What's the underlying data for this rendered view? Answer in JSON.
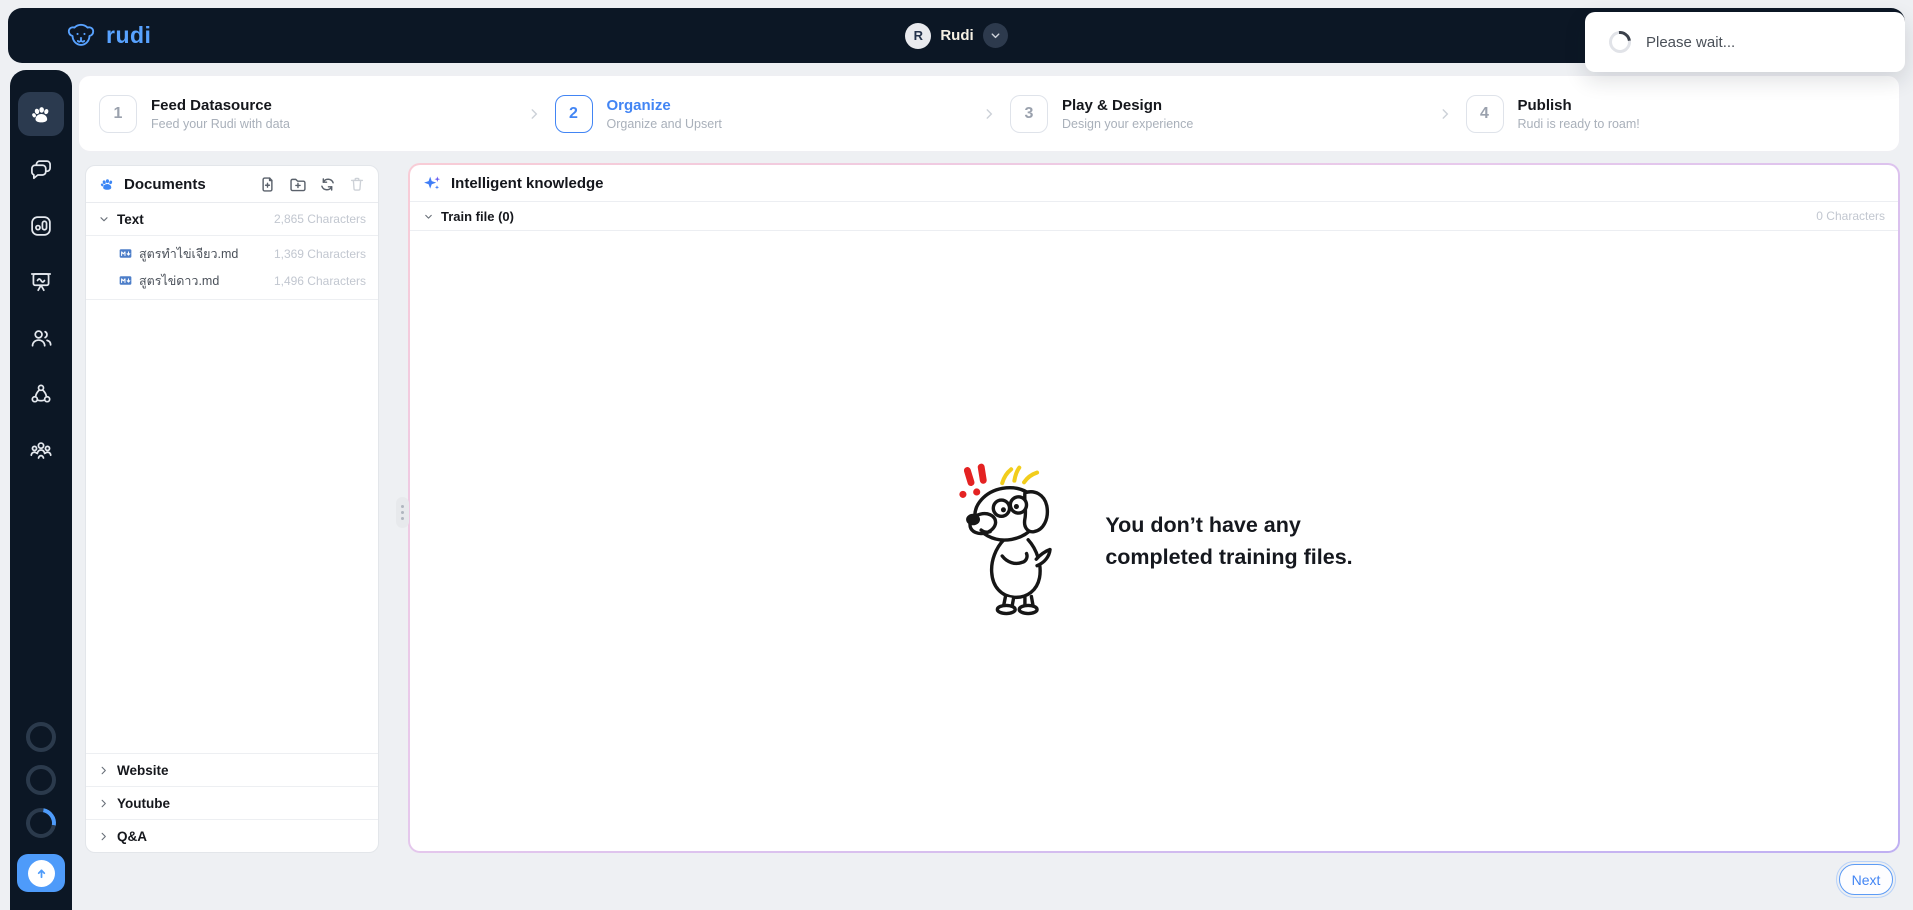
{
  "navbar": {
    "brand": "rudi",
    "user": {
      "initial": "R",
      "name": "Rudi"
    }
  },
  "toast": {
    "message": "Please wait...",
    "icon": "spinner-icon"
  },
  "stepper": {
    "steps": [
      {
        "number": "1",
        "title": "Feed Datasource",
        "subtitle": "Feed your Rudi with data",
        "active": false
      },
      {
        "number": "2",
        "title": "Organize",
        "subtitle": "Organize and Upsert",
        "active": true
      },
      {
        "number": "3",
        "title": "Play & Design",
        "subtitle": "Design your experience",
        "active": false
      },
      {
        "number": "4",
        "title": "Publish",
        "subtitle": "Rudi is ready to roam!",
        "active": false
      }
    ]
  },
  "sidebar": {
    "items": [
      {
        "icon": "paw-icon",
        "active": true
      },
      {
        "icon": "chat-icon",
        "active": false
      },
      {
        "icon": "analytics-icon",
        "active": false
      },
      {
        "icon": "presentation-icon",
        "active": false
      },
      {
        "icon": "users-icon",
        "active": false
      },
      {
        "icon": "network-icon",
        "active": false
      },
      {
        "icon": "team-icon",
        "active": false
      }
    ],
    "status_rings": 3,
    "upload_icon": "arrow-up-icon"
  },
  "documents": {
    "title": "Documents",
    "toolbar": [
      "add-file-icon",
      "add-folder-icon",
      "refresh-icon",
      "delete-icon"
    ],
    "text_section": {
      "label": "Text",
      "count": "2,865 Characters"
    },
    "files": [
      {
        "name": "สูตรทำไข่เจียว.md",
        "count": "1,369 Characters"
      },
      {
        "name": "สูตรไข่ดาว.md",
        "count": "1,496 Characters"
      }
    ],
    "sections": [
      {
        "label": "Website"
      },
      {
        "label": "Youtube"
      },
      {
        "label": "Q&A"
      }
    ]
  },
  "knowledge": {
    "title": "Intelligent knowledge",
    "train_file_label": "Train file (0)",
    "train_file_count": "0 Characters",
    "empty_line1": "You don’t have any",
    "empty_line2": "completed training files."
  },
  "footer": {
    "next_label": "Next"
  },
  "colors": {
    "navy": "#0c1725",
    "brand_blue": "#58a2ff",
    "accent_blue": "#4285f4",
    "button_blue": "#4e9bfa",
    "sidebar_active": "#2b3a4f",
    "muted_gray": "#c2c7d0",
    "panel_border_gradient": [
      "#f8ccd6",
      "#bfb0f2"
    ]
  }
}
